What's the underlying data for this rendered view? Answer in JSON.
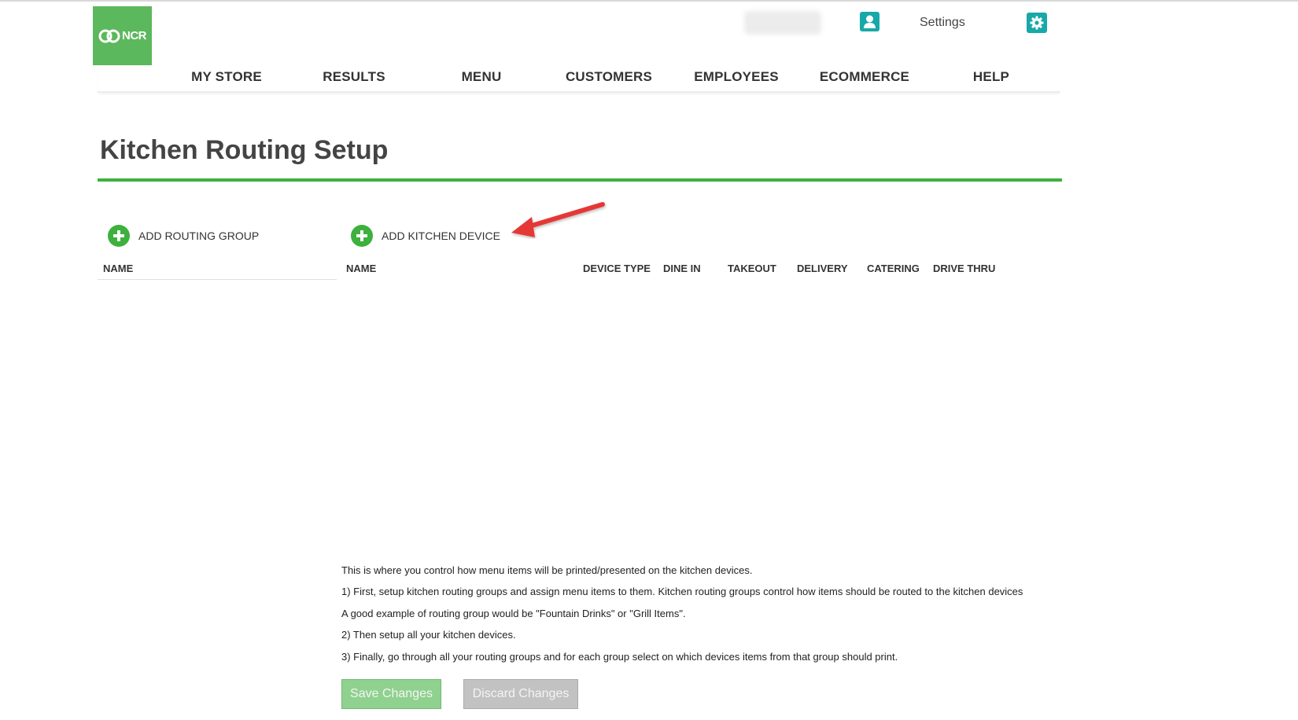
{
  "brand": {
    "logo_text": "NCR",
    "color": "#5cb85c"
  },
  "header": {
    "settings_label": "Settings",
    "accent": "#18a8a8"
  },
  "nav": {
    "items": [
      "MY STORE",
      "RESULTS",
      "MENU",
      "CUSTOMERS",
      "EMPLOYEES",
      "ECOMMERCE",
      "HELP"
    ]
  },
  "page": {
    "title": "Kitchen Routing Setup"
  },
  "routing_groups": {
    "add_label": "ADD ROUTING GROUP",
    "columns": [
      "NAME"
    ]
  },
  "kitchen_devices": {
    "add_label": "ADD KITCHEN DEVICE",
    "columns": [
      "NAME",
      "DEVICE TYPE",
      "DINE IN",
      "TAKEOUT",
      "DELIVERY",
      "CATERING",
      "DRIVE THRU"
    ]
  },
  "info": {
    "lines": [
      "This is where you control how menu items will be printed/presented on the kitchen devices.",
      "1) First, setup kitchen routing groups and assign menu items to them. Kitchen routing groups control how items should be routed to the kitchen devices",
      "A good example of routing group would be \"Fountain Drinks\" or \"Grill Items\".",
      "2) Then setup all your kitchen devices.",
      "3) Finally, go through all your routing groups and for each group select on which devices items from that group should print."
    ]
  },
  "actions": {
    "save_label": "Save Changes",
    "discard_label": "Discard Changes"
  },
  "icons": {
    "logo": "ncr-logo-icon",
    "user": "user-icon",
    "settings": "gear-icon",
    "add": "plus-circle-icon",
    "annotation": "red-arrow-icon"
  }
}
